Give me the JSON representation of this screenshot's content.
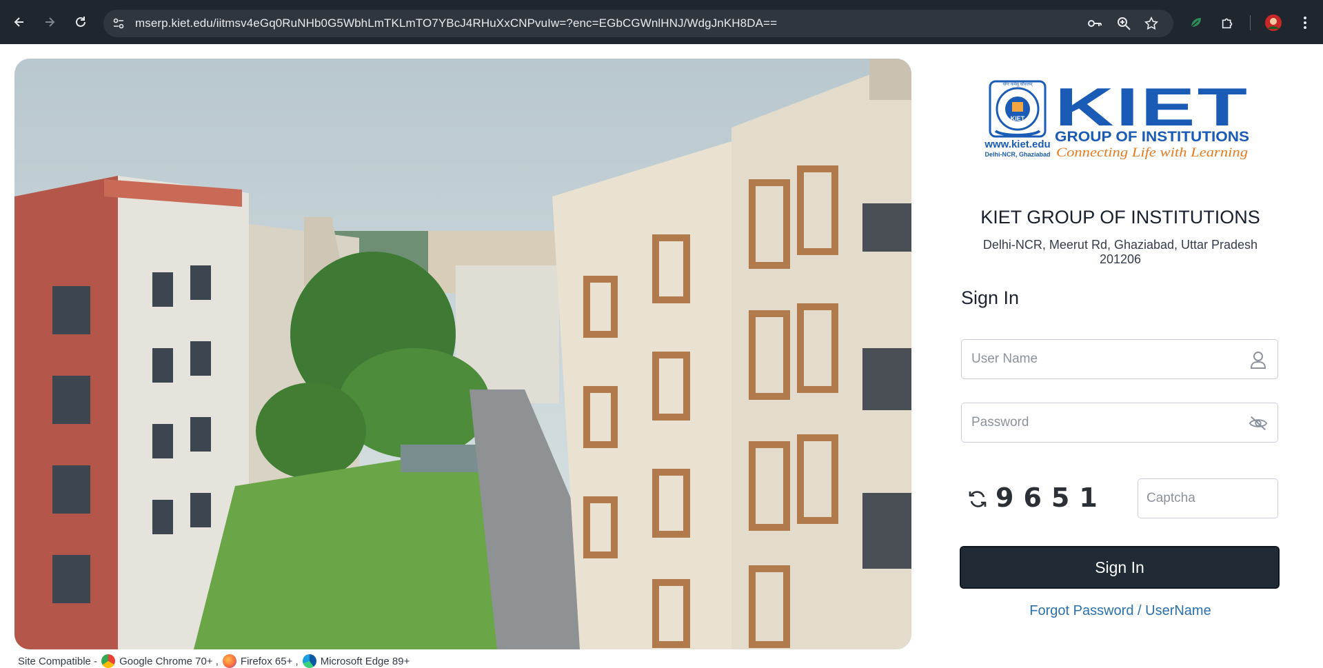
{
  "browser": {
    "url": "mserp.kiet.edu/iitmsv4eGq0RuNHb0G5WbhLmTKLmTO7YBcJ4RHuXxCNPvuIw=?enc=EGbCGWnlHNJ/WdgJnKH8DA=="
  },
  "logo": {
    "seal_top": "योगः कर्मसु कौशलम्",
    "seal_ring": "KIET GROUP OF INSTITUTIONS",
    "seal_center": "KIET",
    "website": "www.kiet.edu",
    "location": "Delhi-NCR, Ghaziabad",
    "wordmark": "KIET",
    "subtitle": "GROUP OF INSTITUTIONS",
    "tagline": "Connecting Life with Learning",
    "brand_blue": "#1a5bb5",
    "brand_orange": "#e87a1e"
  },
  "institution": {
    "name": "KIET GROUP OF INSTITUTIONS",
    "address_line1": "Delhi-NCR, Meerut Rd, Ghaziabad, Uttar Pradesh",
    "address_line2": "201206"
  },
  "form": {
    "heading": "Sign In",
    "username_placeholder": "User Name",
    "password_placeholder": "Password",
    "captcha_code": "9651",
    "captcha_placeholder": "Captcha",
    "submit_label": "Sign In",
    "forgot_label": "Forgot Password / UserName"
  },
  "footer": {
    "compat_label": "Site Compatible -",
    "browsers": [
      "Google Chrome 70+ ,",
      "Firefox 65+ ,",
      "Microsoft Edge 89+"
    ]
  }
}
